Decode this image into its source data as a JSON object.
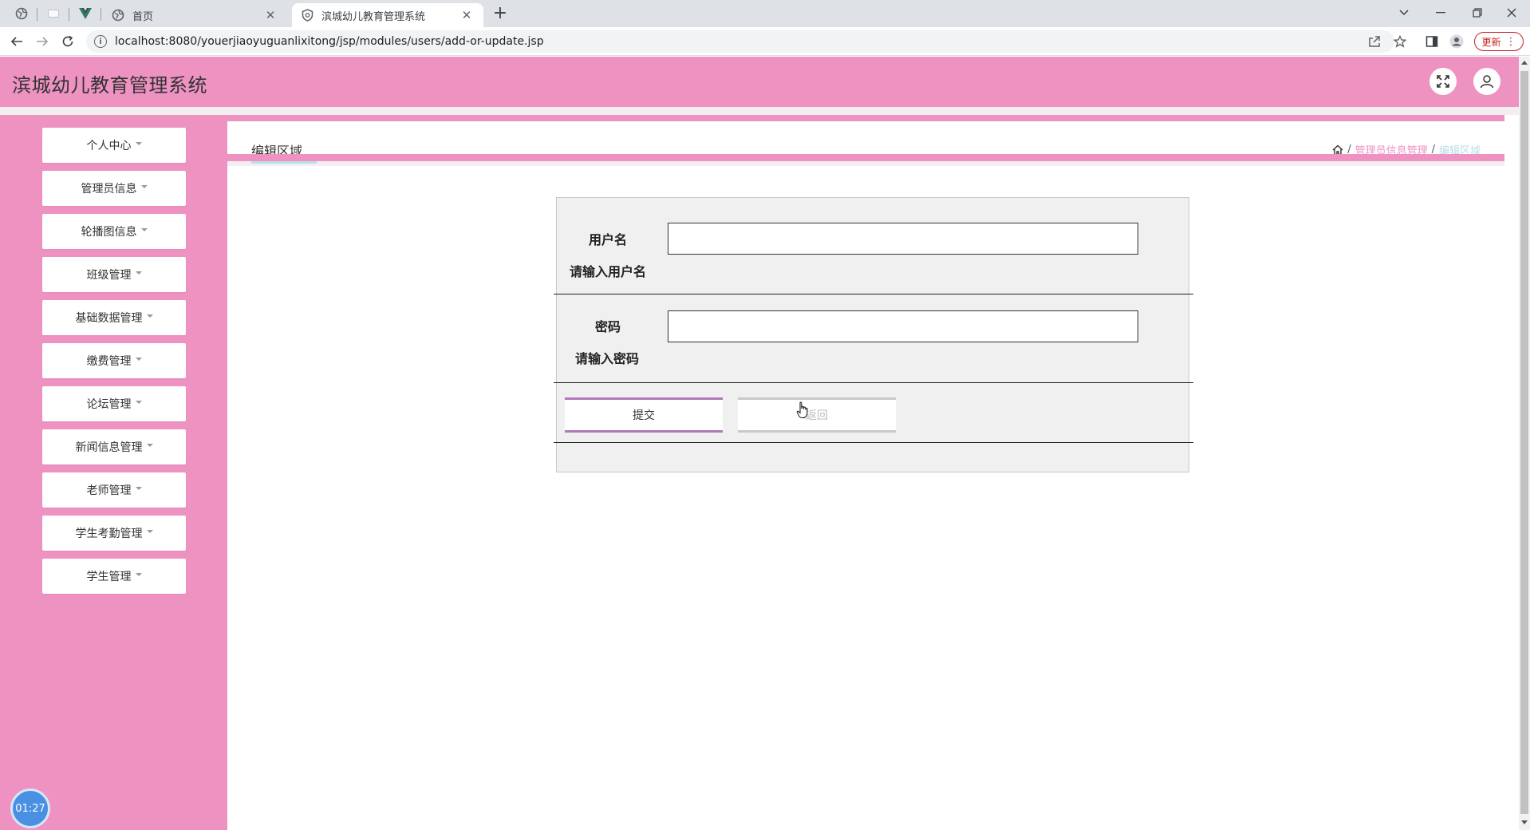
{
  "browser": {
    "tabs": [
      {
        "title": "首页",
        "active": false
      },
      {
        "title": "滨城幼儿教育管理系统",
        "active": true
      }
    ],
    "new_tab": "+",
    "url": "localhost:8080/youerjiaoyuguanlixitong/jsp/modules/users/add-or-update.jsp",
    "update_label": "更新"
  },
  "app": {
    "title": "滨城幼儿教育管理系统",
    "accent_color": "#ee92c2"
  },
  "sidebar": {
    "items": [
      {
        "label": "个人中心"
      },
      {
        "label": "管理员信息"
      },
      {
        "label": "轮播图信息"
      },
      {
        "label": "班级管理"
      },
      {
        "label": "基础数据管理"
      },
      {
        "label": "缴费管理"
      },
      {
        "label": "论坛管理"
      },
      {
        "label": "新闻信息管理"
      },
      {
        "label": "老师管理"
      },
      {
        "label": "学生考勤管理"
      },
      {
        "label": "学生管理"
      }
    ]
  },
  "timer": "01:27",
  "main": {
    "page_title": "编辑区域",
    "breadcrumb": {
      "separator": "/",
      "items": [
        "管理员信息管理",
        "编辑区域"
      ]
    }
  },
  "form": {
    "username": {
      "label": "用户名",
      "hint": "请输入用户名",
      "value": ""
    },
    "password": {
      "label": "密码",
      "hint": "请输入密码",
      "value": ""
    },
    "submit_label": "提交",
    "back_label": "返回"
  }
}
